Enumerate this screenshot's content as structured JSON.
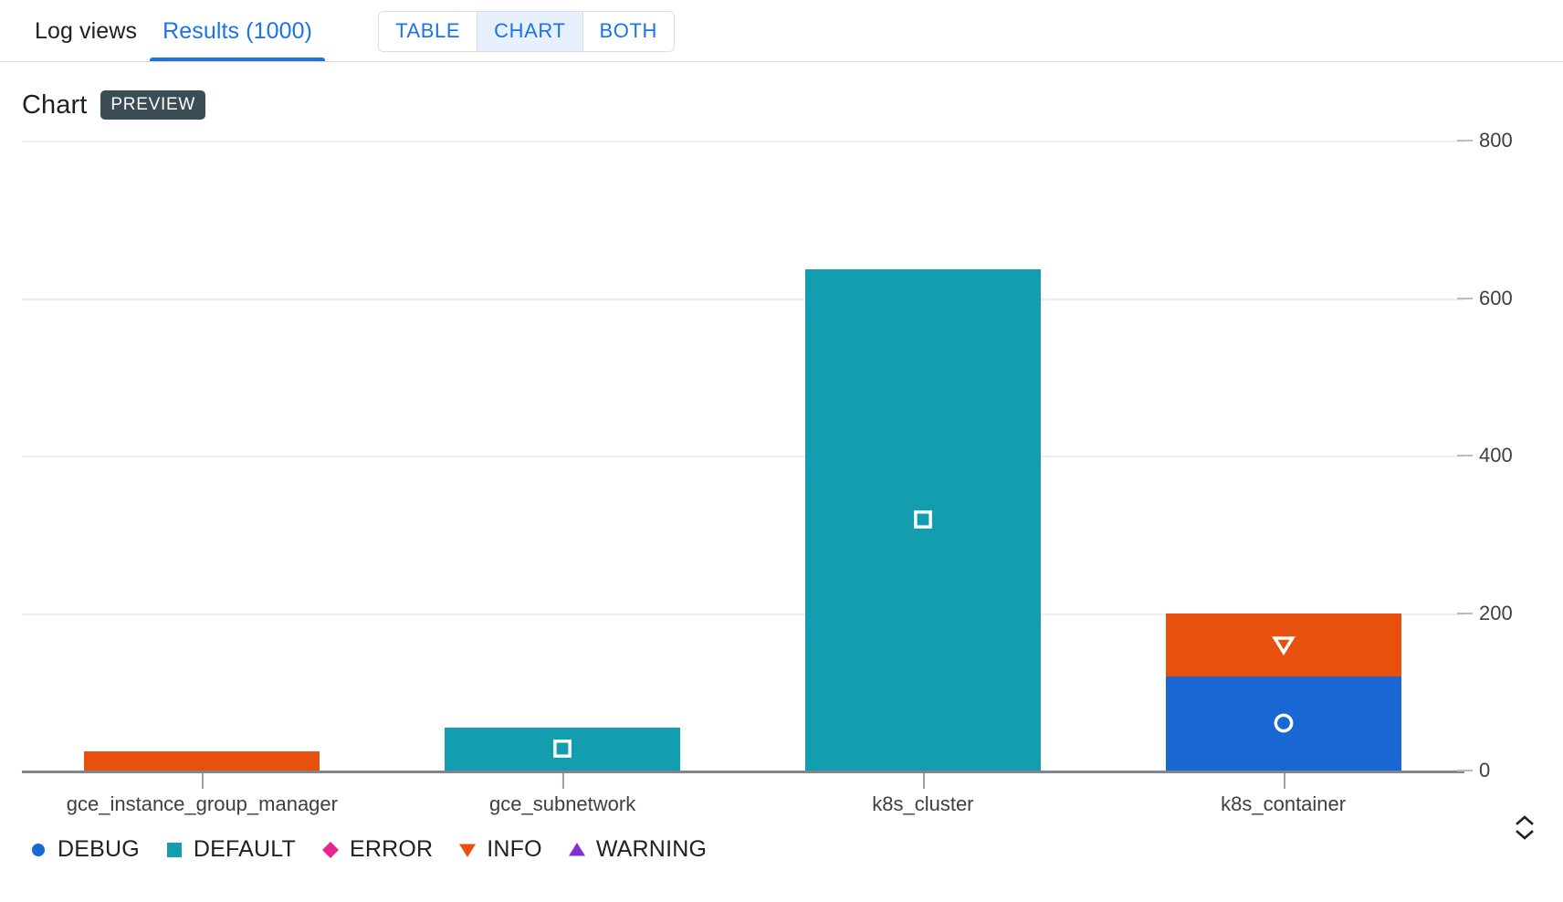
{
  "header": {
    "tabs": [
      {
        "label": "Log views",
        "active": false
      },
      {
        "label": "Results (1000)",
        "active": true
      }
    ],
    "view_toggle": {
      "options": [
        "TABLE",
        "CHART",
        "BOTH"
      ],
      "selected": "CHART"
    }
  },
  "chart_panel": {
    "title": "Chart",
    "badge": "PREVIEW",
    "expander_icon": "unfold-more-icon"
  },
  "colors": {
    "debug": "#1967d2",
    "default": "#129eaf",
    "error": "#e52592",
    "info": "#e8500e",
    "warning": "#8430ce",
    "accent_blue": "#1a73e8",
    "badge_bg": "#3c4c55",
    "axis": "#80868b",
    "gridline": "#eceff1"
  },
  "chart_data": {
    "type": "bar",
    "stacked": true,
    "title": "Chart",
    "xlabel": "",
    "ylabel": "",
    "ylim": [
      0,
      800
    ],
    "yticks": [
      800,
      600,
      400,
      200,
      0
    ],
    "grid": true,
    "legend_position": "bottom-left",
    "categories": [
      "gce_instance_group_manager",
      "gce_subnetwork",
      "k8s_cluster",
      "k8s_container"
    ],
    "series": [
      {
        "name": "DEBUG",
        "marker": "circle",
        "color": "#1967d2",
        "values": [
          0,
          0,
          0,
          120
        ]
      },
      {
        "name": "DEFAULT",
        "marker": "square",
        "color": "#129eaf",
        "values": [
          0,
          55,
          637,
          0
        ]
      },
      {
        "name": "ERROR",
        "marker": "diamond",
        "color": "#e52592",
        "values": [
          0,
          0,
          0,
          0
        ]
      },
      {
        "name": "INFO",
        "marker": "triangle-down",
        "color": "#e8500e",
        "values": [
          24,
          0,
          0,
          80
        ]
      },
      {
        "name": "WARNING",
        "marker": "triangle-up",
        "color": "#8430ce",
        "values": [
          0,
          0,
          0,
          0
        ]
      }
    ],
    "legend": [
      "DEBUG",
      "DEFAULT",
      "ERROR",
      "INFO",
      "WARNING"
    ]
  }
}
